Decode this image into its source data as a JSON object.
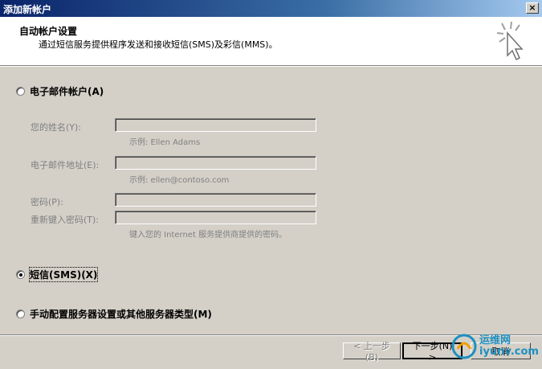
{
  "window": {
    "title": "添加新帐户",
    "close_glyph": "×"
  },
  "header": {
    "title": "自动帐户设置",
    "subtitle": "通过短信服务提供程序发送和接收短信(SMS)及彩信(MMS)。"
  },
  "options": {
    "email": {
      "label": "电子邮件帐户(A)",
      "selected": false
    },
    "sms": {
      "label": "短信(SMS)(X)",
      "selected": true
    },
    "manual": {
      "label": "手动配置服务器设置或其他服务器类型(M)",
      "selected": false
    }
  },
  "fields": {
    "name": {
      "label": "您的姓名(Y):",
      "value": "",
      "hint": "示例: Ellen Adams"
    },
    "email": {
      "label": "电子邮件地址(E):",
      "value": "",
      "hint": "示例: ellen@contoso.com"
    },
    "password": {
      "label": "密码(P):",
      "value": ""
    },
    "retype": {
      "label": "重新键入密码(T):",
      "value": "",
      "hint": "键入您的 Internet 服务提供商提供的密码。"
    }
  },
  "buttons": {
    "back": "< 上一步(B)",
    "next": "下一步(N) >",
    "cancel": "取消"
  },
  "watermark": {
    "line1": "运维网",
    "line2": "iyunv.com"
  },
  "colors": {
    "dialog_bg": "#d4d0c8",
    "titlebar": "#0a246a",
    "disabled_text": "#808080",
    "watermark": "#1e8fc0"
  }
}
